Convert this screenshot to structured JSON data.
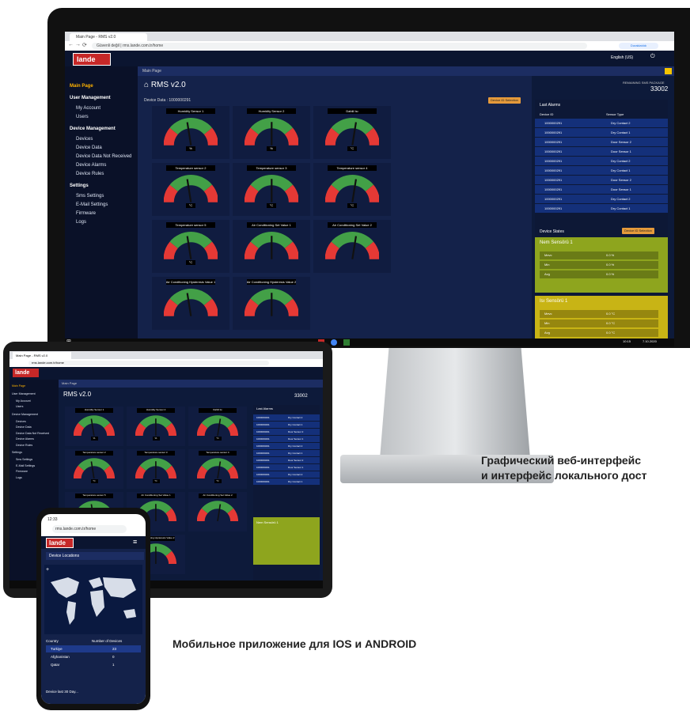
{
  "browser": {
    "tab_title": "Main Page - RMS v2.0",
    "address": "rms.lande.com.tr/home",
    "insecure": "Güvenli değil",
    "profile": "Duraklatıldı"
  },
  "app": {
    "logo": "lande",
    "language": "English (US)",
    "breadcrumb": "Main Page",
    "title": "RMS v2.0",
    "remaining_label": "REMAINING SMS PACKAGE",
    "remaining_value": "33002",
    "device_data_label": "Device Data : 1000000291",
    "device_btn": "Device ID Selection"
  },
  "sidebar": {
    "items": [
      {
        "label": "Main Page",
        "type": "active"
      },
      {
        "label": "User Management",
        "type": "hdr"
      },
      {
        "label": "My Account",
        "type": "sub"
      },
      {
        "label": "Users",
        "type": "sub"
      },
      {
        "label": "Device Management",
        "type": "hdr"
      },
      {
        "label": "Devices",
        "type": "sub"
      },
      {
        "label": "Device Data",
        "type": "sub"
      },
      {
        "label": "Device Data Not Received",
        "type": "sub"
      },
      {
        "label": "Device Alarms",
        "type": "sub"
      },
      {
        "label": "Device Rules",
        "type": "sub"
      },
      {
        "label": "Settings",
        "type": "hdr"
      },
      {
        "label": "Sms Settings",
        "type": "sub"
      },
      {
        "label": "E-Mail Settings",
        "type": "sub"
      },
      {
        "label": "Firmware",
        "type": "sub"
      },
      {
        "label": "Logs",
        "type": "sub"
      }
    ]
  },
  "gauges": [
    {
      "label": "Humidity Sensor 1",
      "unit": "%"
    },
    {
      "label": "Humidity Sensor 2",
      "unit": "%"
    },
    {
      "label": "Dahili Isı",
      "unit": "°C"
    },
    {
      "label": "Temperature sensor 2",
      "unit": "°C"
    },
    {
      "label": "Temperature sensor 3",
      "unit": "°C"
    },
    {
      "label": "Temperature sensor 4",
      "unit": "°C"
    },
    {
      "label": "Temperature sensor 5",
      "unit": "°C"
    },
    {
      "label": "Air Conditioning Set Value 1",
      "unit": ""
    },
    {
      "label": "Air Conditioning Set Value 2",
      "unit": ""
    },
    {
      "label": "Air Conditioning Hysteresis Value 1",
      "unit": ""
    },
    {
      "label": "Air Conditioning Hysteresis Value 2",
      "unit": ""
    }
  ],
  "last_alarms": {
    "title": "Last Alarms",
    "col_device": "Device ID",
    "col_sensor": "Sensor Type",
    "rows": [
      [
        "1000000291",
        "Dry Contact 2"
      ],
      [
        "1000000291",
        "Dry Contact 1"
      ],
      [
        "1000000291",
        "Door Sensor 2"
      ],
      [
        "1000000291",
        "Door Sensor 1"
      ],
      [
        "1000000291",
        "Dry Contact 2"
      ],
      [
        "1000000291",
        "Dry Contact 1"
      ],
      [
        "1000000291",
        "Door Sensor 2"
      ],
      [
        "1000000291",
        "Door Sensor 1"
      ],
      [
        "1000000291",
        "Dry Contact 2"
      ],
      [
        "1000000291",
        "Dry Contact 1"
      ]
    ]
  },
  "device_states": {
    "title": "Device States",
    "btn": "Device ID Selection",
    "cards": [
      {
        "title": "Nem Sensörü 1",
        "rows": [
          [
            "Mevc",
            "0.0 %"
          ],
          [
            "Min",
            "0.0 %"
          ],
          [
            "Avg",
            "0.0 %"
          ]
        ]
      },
      {
        "title": "Isı Sensörü 1",
        "rows": [
          [
            "Mevc",
            "0.0 °C"
          ],
          [
            "Min",
            "0.0 °C"
          ],
          [
            "Avg",
            "0.0 °C"
          ]
        ]
      }
    ]
  },
  "taskbar": {
    "time": "10:15",
    "date": "7.10.2020"
  },
  "phone": {
    "time": "12:33",
    "address": "rms.lande.com.tr/home",
    "logo": "lande",
    "panel_title": "Device Locations",
    "col_country": "Country",
    "col_count": "Number of Devices",
    "rows": [
      [
        "Turkiye",
        "23"
      ],
      [
        "Afghanistan",
        "0"
      ],
      [
        "Qatar",
        "1"
      ]
    ],
    "footer": "Device last 30 Day..."
  },
  "captions": {
    "web_line1": "Графический веб-интерфейс",
    "web_line2": "и интерфейс локального дост",
    "mobile": "Мобильное приложение для IOS и ANDROID"
  }
}
